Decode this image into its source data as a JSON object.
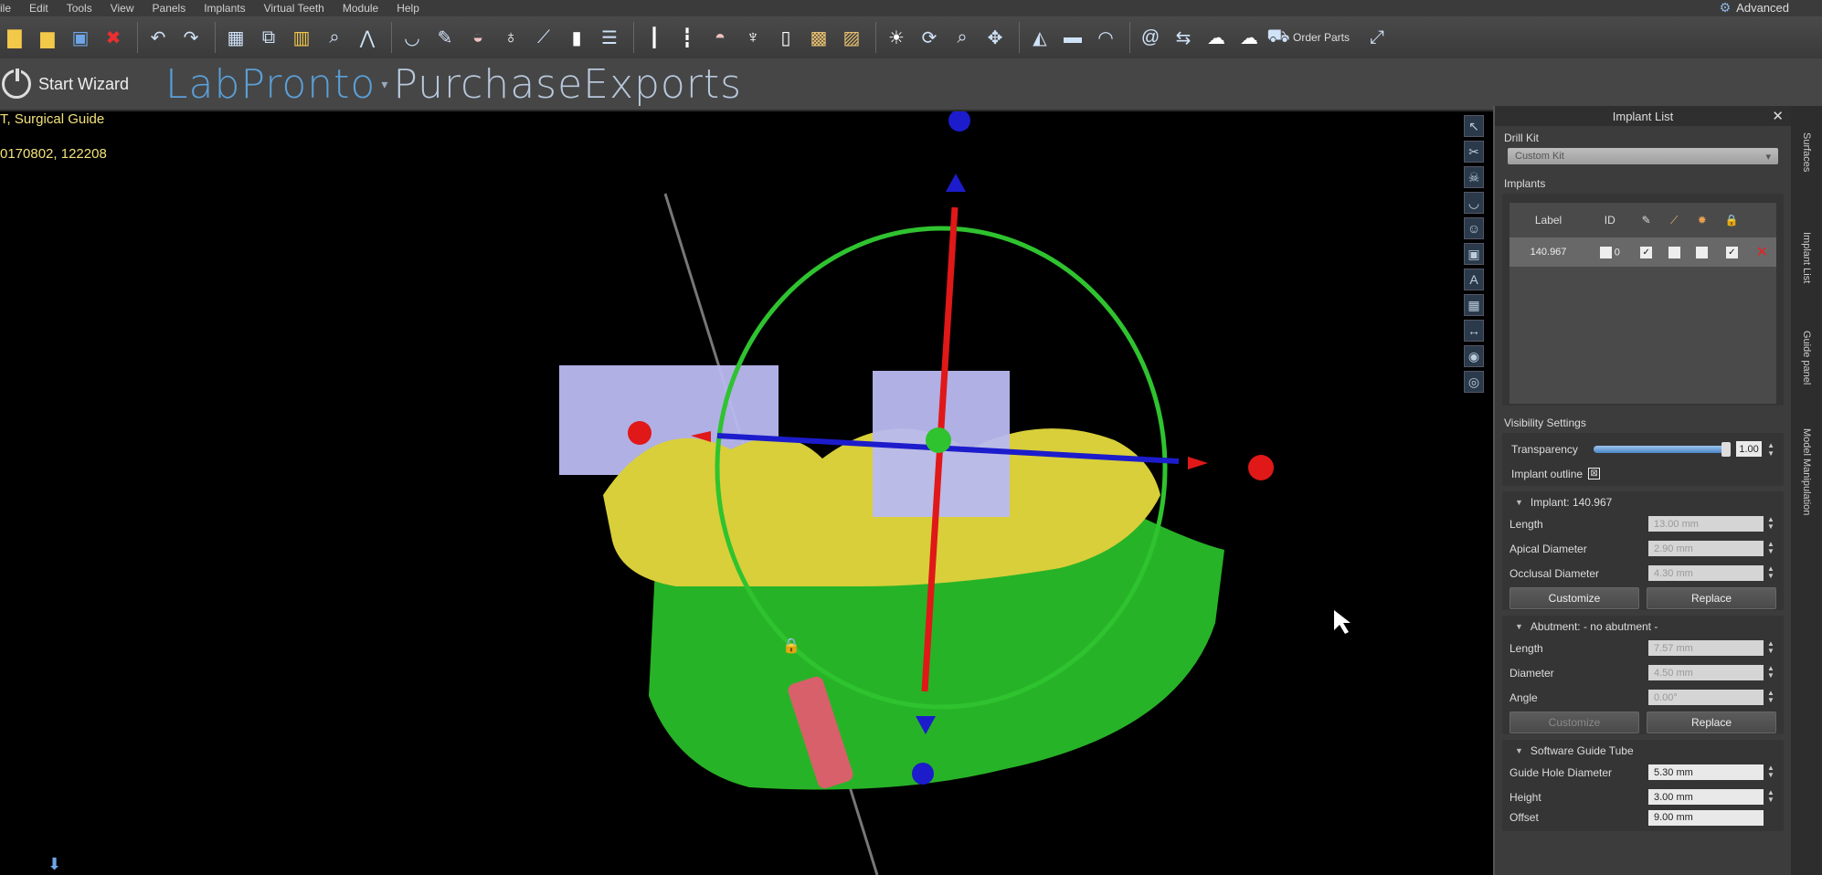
{
  "menu": [
    "ile",
    "Edit",
    "Tools",
    "View",
    "Panels",
    "Implants",
    "Virtual Teeth",
    "Module",
    "Help"
  ],
  "mode": {
    "label": "Advanced",
    "icon": "user-gear-icon"
  },
  "toolbar": {
    "order_parts_label": "Order Parts"
  },
  "wizard": {
    "start_label": "Start Wizard"
  },
  "logo": {
    "part1": "LabPronto",
    "part2": "PurchaseExports"
  },
  "viewport": {
    "line1": "T, Surgical Guide",
    "line2": "0170802, 122208"
  },
  "panel": {
    "title": "Implant List",
    "drill_kit": {
      "label": "Drill Kit",
      "value": "Custom Kit"
    },
    "implants": {
      "label": "Implants",
      "columns": {
        "label": "Label",
        "id": "ID"
      },
      "rows": [
        {
          "label": "140.967",
          "id": "0"
        }
      ]
    },
    "visibility": {
      "label": "Visibility Settings",
      "transparency_label": "Transparency",
      "transparency_value": "1.00",
      "transparency_level": 1.0,
      "outline_label": "Implant outline"
    },
    "implant_group": {
      "title": "Implant: 140.967",
      "length_label": "Length",
      "length_value": "13.00 mm",
      "apical_label": "Apical Diameter",
      "apical_value": "2.90 mm",
      "occlusal_label": "Occlusal Diameter",
      "occlusal_value": "4.30 mm",
      "customize": "Customize",
      "replace": "Replace"
    },
    "abutment_group": {
      "title": "Abutment: - no abutment -",
      "length_label": "Length",
      "length_value": "7.57 mm",
      "diameter_label": "Diameter",
      "diameter_value": "4.50 mm",
      "angle_label": "Angle",
      "angle_value": "0.00°",
      "customize": "Customize",
      "replace": "Replace"
    },
    "tube_group": {
      "title": "Software Guide Tube",
      "hole_label": "Guide Hole Diameter",
      "hole_value": "5.30 mm",
      "height_label": "Height",
      "height_value": "3.00 mm",
      "offset_label": "Offset",
      "offset_value": "9.00 mm"
    }
  },
  "side_tabs": [
    "Surfaces",
    "Implant List",
    "Guide panel",
    "Model Manipulation"
  ]
}
